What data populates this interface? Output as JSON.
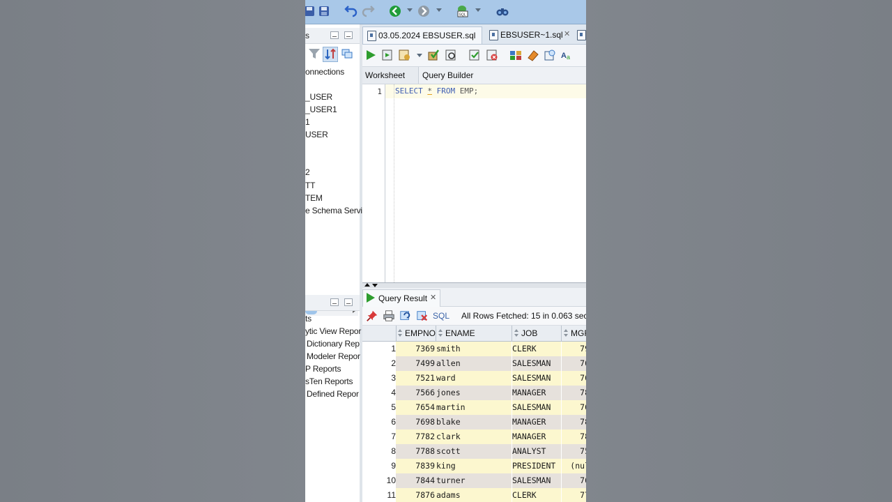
{
  "left_panel": {
    "connections_header": "s",
    "connections_label": "onnections",
    "tree_items": [
      "_USER",
      "_USER1",
      "1",
      "USER",
      "2",
      "TT",
      "TEM",
      "e Schema Servi"
    ],
    "reports_header": "ts",
    "report_items": [
      "ytic View Repor",
      "Dictionary Rep",
      "Modeler Repor",
      "P Reports",
      "sTen Reports",
      "Defined Repor"
    ]
  },
  "file_tabs": [
    {
      "label": "03.05.2024 EBSUSER.sql"
    },
    {
      "label": "EBSUSER~1.sql"
    }
  ],
  "sub_tabs": {
    "worksheet": "Worksheet",
    "query_builder": "Query Builder"
  },
  "editor": {
    "line_number": "1",
    "kw_select": "SELECT",
    "star": "*",
    "kw_from": "FROM",
    "table": "EMP;"
  },
  "result": {
    "tab_label": "Query Result",
    "sql_link": "SQL",
    "status": "All Rows Fetched: 15 in 0.063 seco",
    "columns": [
      "EMPNO",
      "ENAME",
      "JOB",
      "MGR"
    ],
    "rows": [
      {
        "n": "1",
        "empno": "7369",
        "ename": "smith",
        "job": "CLERK",
        "mgr": "79"
      },
      {
        "n": "2",
        "empno": "7499",
        "ename": "allen",
        "job": "SALESMAN",
        "mgr": "76"
      },
      {
        "n": "3",
        "empno": "7521",
        "ename": "ward",
        "job": "SALESMAN",
        "mgr": "76"
      },
      {
        "n": "4",
        "empno": "7566",
        "ename": "jones",
        "job": "MANAGER",
        "mgr": "78"
      },
      {
        "n": "5",
        "empno": "7654",
        "ename": "martin",
        "job": "SALESMAN",
        "mgr": "76"
      },
      {
        "n": "6",
        "empno": "7698",
        "ename": "blake",
        "job": "MANAGER",
        "mgr": "78"
      },
      {
        "n": "7",
        "empno": "7782",
        "ename": "clark",
        "job": "MANAGER",
        "mgr": "78"
      },
      {
        "n": "8",
        "empno": "7788",
        "ename": "scott",
        "job": "ANALYST",
        "mgr": "75"
      },
      {
        "n": "9",
        "empno": "7839",
        "ename": "king",
        "job": "PRESIDENT",
        "mgr": "(nul"
      },
      {
        "n": "10",
        "empno": "7844",
        "ename": "turner",
        "job": "SALESMAN",
        "mgr": "76"
      },
      {
        "n": "11",
        "empno": "7876",
        "ename": "adams",
        "job": "CLERK",
        "mgr": "77"
      }
    ]
  },
  "colors": {
    "toolbar_bg": "#a9c8e8",
    "row_odd": "#fcf7cf",
    "row_even": "#e6e1dc",
    "keyword": "#3d5db3",
    "run_green": "#2e9d2e"
  }
}
